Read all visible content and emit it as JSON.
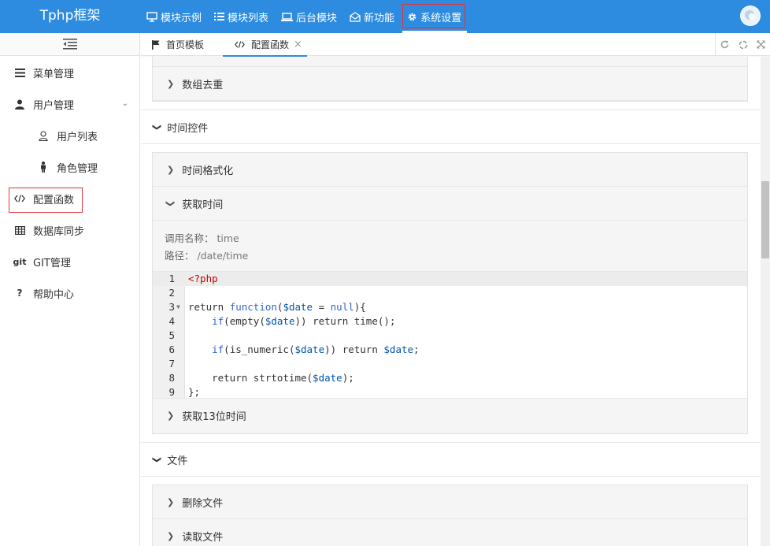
{
  "header": {
    "logo": "Tphp框架",
    "nav": [
      {
        "label": "模块示例",
        "icon": "monitor-icon"
      },
      {
        "label": "模块列表",
        "icon": "list-icon"
      },
      {
        "label": "后台模块",
        "icon": "laptop-icon"
      },
      {
        "label": "新功能",
        "icon": "envelope-open-icon"
      },
      {
        "label": "系统设置",
        "icon": "gear-icon"
      }
    ],
    "active_nav": "系统设置"
  },
  "sidebar": {
    "items": [
      {
        "label": "菜单管理",
        "icon": "bars-icon"
      },
      {
        "label": "用户管理",
        "icon": "user-icon"
      },
      {
        "label": "用户列表",
        "icon": "user-outline-icon"
      },
      {
        "label": "角色管理",
        "icon": "person-icon"
      },
      {
        "label": "配置函数",
        "icon": "code-icon"
      },
      {
        "label": "数据库同步",
        "icon": "table-icon"
      },
      {
        "label": "GIT管理",
        "icon": "git-icon",
        "icon_text": "git"
      },
      {
        "label": "帮助中心",
        "icon": "question-icon",
        "icon_text": "?"
      }
    ],
    "selected": "配置函数"
  },
  "tabs": [
    {
      "label": "首页模板",
      "icon": "flag-icon"
    },
    {
      "label": "配置函数",
      "icon": "code-icon",
      "closable": true
    }
  ],
  "active_tab": "配置函数",
  "content": {
    "items": {
      "dedupe": "数组去重",
      "time_group": "时间控件",
      "time_format": "时间格式化",
      "get_time": "获取时间",
      "get_time13": "获取13位时间",
      "file_group": "文件",
      "delete_file": "删除文件",
      "read_file": "读取文件"
    },
    "get_time_detail": {
      "call_label": "调用名称：",
      "call_value": "time",
      "path_label": "路径：",
      "path_value": "/date/time"
    },
    "code": {
      "line_numbers": [
        "1",
        "2",
        "3",
        "4",
        "5",
        "6",
        "7",
        "8",
        "9"
      ]
    }
  },
  "colors": {
    "header_bg": "#2d8ce0",
    "highlight_border": "#e0333a",
    "active_tab_line": "#2d8ce0"
  }
}
